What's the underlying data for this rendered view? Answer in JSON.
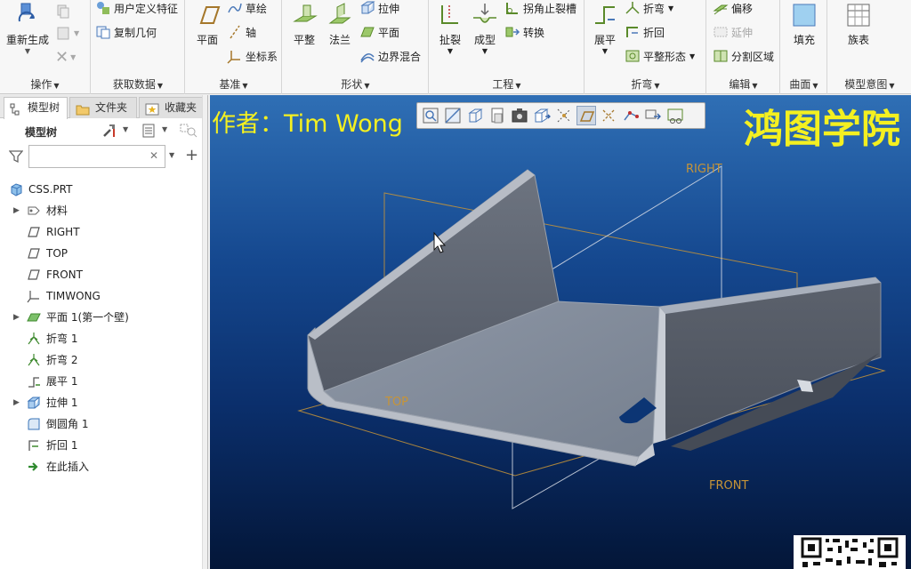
{
  "ribbon": {
    "groups": [
      {
        "label": "操作"
      },
      {
        "label": "获取数据"
      },
      {
        "label": "基准"
      },
      {
        "label": "形状"
      },
      {
        "label": "工程"
      },
      {
        "label": "折弯"
      },
      {
        "label": "编辑"
      },
      {
        "label": "曲面"
      },
      {
        "label": "模型意图"
      }
    ],
    "operations": {
      "regenerate": "重新生成"
    },
    "get_data": {
      "udf": "用户定义特征",
      "copy_geometry": "复制几何"
    },
    "datum": {
      "plane": "平面",
      "sketch": "草绘",
      "axis": "轴",
      "csys": "坐标系"
    },
    "shapes": {
      "flat": "平整",
      "flange": "法兰",
      "extrude": "拉伸",
      "planar": "平面",
      "boundary_blend": "边界混合"
    },
    "engineering": {
      "rip": "扯裂",
      "form": "成型",
      "corner_relief": "拐角止裂槽",
      "convert": "转换"
    },
    "bend": {
      "unbend": "展平",
      "bend": "折弯",
      "bend_back": "折回",
      "flatten_form": "平整形态"
    },
    "edit": {
      "offset": "偏移",
      "extend": "延伸",
      "split_area": "分割区域"
    },
    "surface": {
      "fill": "填充"
    },
    "model_intent": {
      "family_table": "族表"
    }
  },
  "left_panel": {
    "tabs": [
      "模型树",
      "文件夹",
      "收藏夹"
    ],
    "tree_title": "模型树",
    "filter_placeholder": "",
    "tree_items": [
      {
        "label": "CSS.PRT",
        "icon": "part-icon",
        "expandable": false
      },
      {
        "label": "材料",
        "icon": "material-icon",
        "expandable": true
      },
      {
        "label": "RIGHT",
        "icon": "datum-plane-icon",
        "expandable": false
      },
      {
        "label": "TOP",
        "icon": "datum-plane-icon",
        "expandable": false
      },
      {
        "label": "FRONT",
        "icon": "datum-plane-icon",
        "expandable": false
      },
      {
        "label": "TIMWONG",
        "icon": "csys-icon",
        "expandable": false
      },
      {
        "label": "平面 1(第一个壁)",
        "icon": "flat-wall-icon",
        "expandable": true
      },
      {
        "label": "折弯 1",
        "icon": "bend-icon",
        "expandable": false
      },
      {
        "label": "折弯 2",
        "icon": "bend-icon",
        "expandable": false
      },
      {
        "label": "展平 1",
        "icon": "unbend-icon",
        "expandable": false
      },
      {
        "label": "拉伸 1",
        "icon": "extrude-icon",
        "expandable": true
      },
      {
        "label": "倒圆角 1",
        "icon": "round-icon",
        "expandable": false
      },
      {
        "label": "折回 1",
        "icon": "bend-back-icon",
        "expandable": false
      },
      {
        "label": "在此插入",
        "icon": "insert-here-icon",
        "expandable": false
      }
    ]
  },
  "viewport": {
    "author": "作者：Tim Wong",
    "brand": "鸿图学院",
    "plane_labels": {
      "right": "RIGHT",
      "top": "TOP",
      "front": "FRONT"
    }
  },
  "colors": {
    "viewport_top": "#2f6fb5",
    "viewport_bottom": "#031638",
    "overlay_text": "#f4f020",
    "datum_plane": "#c79437"
  }
}
